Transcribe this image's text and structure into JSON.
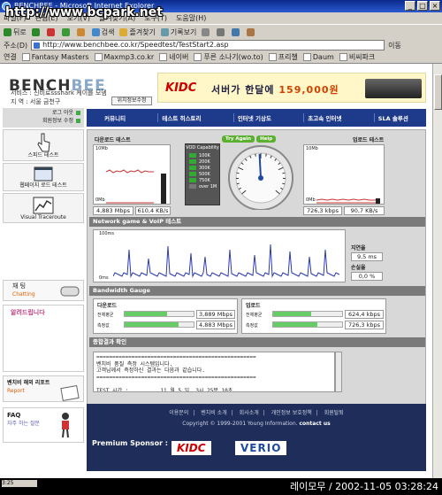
{
  "window": {
    "title": "BENCHBEE - Microsoft Internet Explorer",
    "watermark": "http://www.bcpark.net"
  },
  "menu": [
    "파일(F)",
    "편집(E)",
    "보기(V)",
    "즐겨찾기(A)",
    "도구(T)",
    "도움말(H)"
  ],
  "toolbar": {
    "back": "뒤로",
    "search": "검색",
    "favorites": "즐겨찾기",
    "history": "기록보기"
  },
  "address": {
    "label": "주소(D)",
    "url": "http://www.benchbee.co.kr/Speedtest/TestStart2.asp",
    "go": "이동"
  },
  "links": {
    "label": "연결",
    "items": [
      "Fantasy Masters",
      "Maxmp3.co.kr",
      "네이버",
      "푸른 소나기(wo.to)",
      "프리챌",
      "Daum",
      "비씨파크"
    ]
  },
  "header": {
    "logo_a": "BENCH",
    "logo_b": "BEE",
    "service_line": "서비스 : 신비로ssshark 케이블 모뎀",
    "location_line": "지  역 : 서울 금천구",
    "location_button": "위치정보수정"
  },
  "banner": {
    "brand": "KIDC",
    "text": "서버가 한달에",
    "price": "159,000원"
  },
  "login": {
    "logout": "로그 아웃",
    "member": "회원정보 수정"
  },
  "leftnav": {
    "speed_test": "스피드 테스트",
    "webpage_test": "웹페이지 로드 테스트",
    "traceroute": "Visual Traceroute",
    "chat_title": "채 팅",
    "chat_sub": "Chatting",
    "notice": "알려드립니다",
    "report_title": "벤치비 해외 리포트",
    "report_sub": "Report",
    "faq_title": "FAQ",
    "faq_sub": "자주 하는 질문"
  },
  "mainnav": [
    "커뮤니티",
    "테스트 히스토리",
    "인터넷 기상도",
    "초고속 인터넷",
    "SLA 솔루션"
  ],
  "speedtest": {
    "download_title": "다운로드 테스트",
    "upload_title": "업로드 테스트",
    "graph_max": "10Mb",
    "graph_min": "0Mb",
    "download_mbps": "4,883 Mbps",
    "download_kbs": "610,4 KB/s",
    "upload_kbps": "726,3 kbps",
    "upload_kbs": "90,7 KB/s",
    "vod_title": "VOD Capability",
    "vod_levels": [
      "100K",
      "200K",
      "300K",
      "500K",
      "750K",
      "over 1M"
    ],
    "try_again": "Try Again",
    "help": "Help",
    "download_gauge_level": 0.4883
  },
  "gamevoip": {
    "title": "Network game & VoIP 테스트",
    "max": "100ms",
    "min": "0ms",
    "latency_label": "지연율",
    "latency_value": "9,5 ms",
    "loss_label": "손실율",
    "loss_value": "0,0 %"
  },
  "bandwidth": {
    "title": "Bandwidth Gauge",
    "download_label": "다운로드",
    "upload_label": "업로드",
    "avg_label": "전체평균",
    "measured_label": "측정값",
    "dl_avg": "3,889 Mbps",
    "dl_measured": "4,883 Mbps",
    "ul_avg": "624,4 kbps",
    "ul_measured": "726,3 kbps",
    "dl_avg_fill": 0.62,
    "dl_measured_fill": 0.78,
    "ul_avg_fill": 0.55,
    "ul_measured_fill": 0.64
  },
  "summary": {
    "title": "종합결과 확인",
    "text": "==================================================\n벤치비 품질 측정 시스템입니다.\n고객님께서 측정하신 결과는 다음과 같습니다.\n==================================================\n\nTEST 시간 :          11 월 5 일  3시 25분 10초"
  },
  "footer": {
    "links": [
      "이용문의",
      "벤치비 소개",
      "회사소개",
      "개인정보 보호정책",
      "회원탈퇴"
    ],
    "copyright": "Copyright © 1999-2001 Young Information.",
    "contact": "contact us",
    "sponsor_label": "Premium Sponsor :",
    "sponsor_1": "KIDC",
    "sponsor_2": "VERIO"
  },
  "status": {
    "left": "3:25",
    "stamp": "레이모무 / 2002-11-05 03:28:24"
  }
}
